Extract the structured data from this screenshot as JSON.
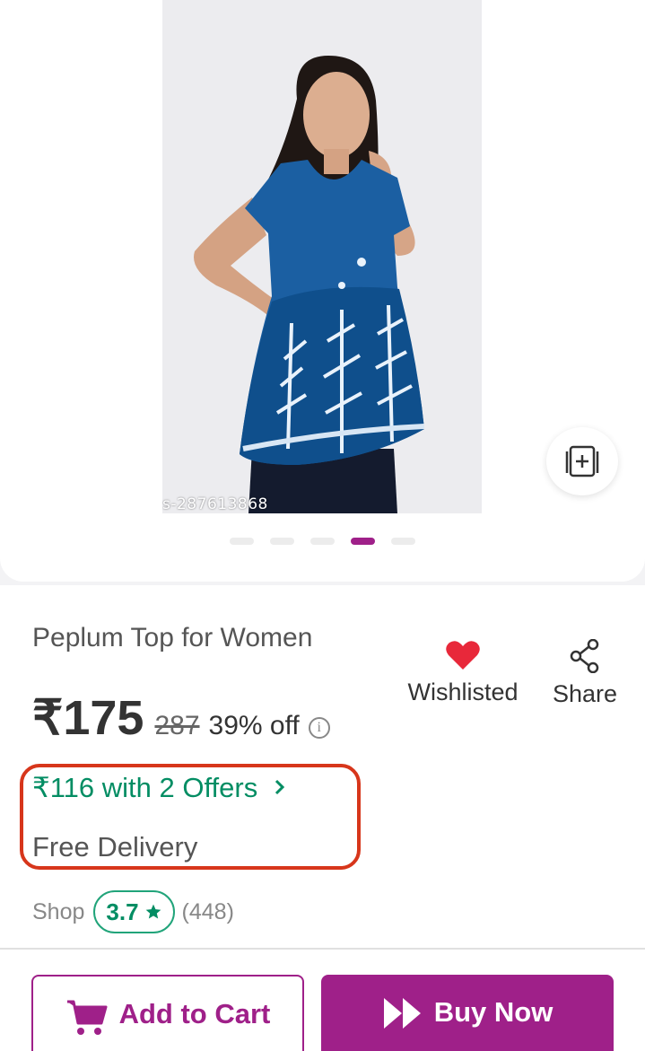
{
  "product": {
    "image_code": "s-287613868",
    "carousel_count": 5,
    "carousel_active_index": 3,
    "title": "Peplum Top for Women",
    "price": "₹175",
    "mrp": "287",
    "discount": "39% off",
    "offer_text": "₹116 with 2 Offers",
    "delivery": "Free Delivery"
  },
  "actions": {
    "wishlist_label": "Wishlisted",
    "share_label": "Share"
  },
  "shop": {
    "label": "Shop",
    "rating": "3.7",
    "reviews": "(448)"
  },
  "buttons": {
    "add_to_cart": "Add to Cart",
    "buy_now": "Buy Now"
  },
  "icons": {
    "collection": "add-to-collection-icon",
    "heart": "heart-filled-icon",
    "share": "share-icon",
    "info": "info-icon",
    "star": "star-icon",
    "cart": "cart-icon",
    "buy": "fast-forward-icon"
  },
  "colors": {
    "brand": "#9f2089",
    "offer_green": "#038d63",
    "heart_red": "#e8283a",
    "highlight_red": "#d7361b"
  }
}
